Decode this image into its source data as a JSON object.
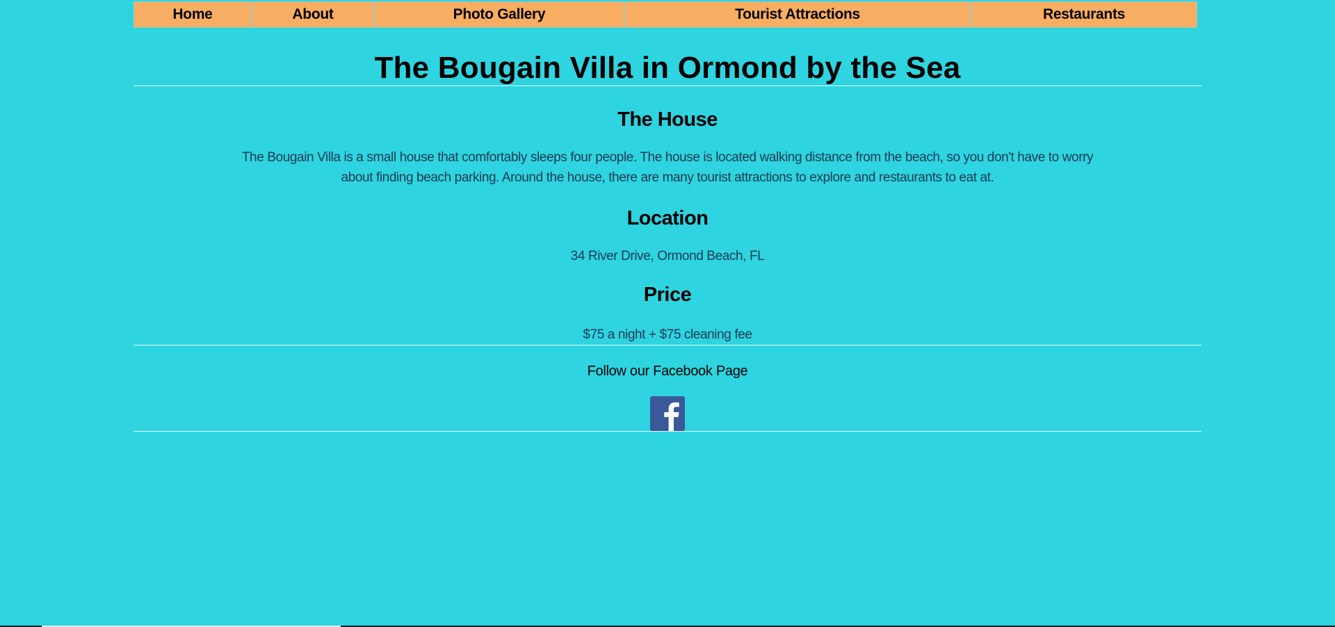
{
  "nav": {
    "items": [
      {
        "label": "Home"
      },
      {
        "label": "About"
      },
      {
        "label": "Photo Gallery"
      },
      {
        "label": "Tourist Attractions"
      },
      {
        "label": "Restaurants"
      }
    ]
  },
  "header": {
    "title": "The Bougain Villa in Ormond by the Sea"
  },
  "sections": {
    "house": {
      "heading": "The House",
      "text": "The Bougain Villa is a small house that comfortably sleeps four people. The house is located walking distance from the beach, so you don't have to worry about finding beach parking. Around the house, there are many tourist attractions to explore and restaurants to eat at."
    },
    "location": {
      "heading": "Location",
      "text": "34 River Drive, Ormond Beach, FL"
    },
    "price": {
      "heading": "Price",
      "text": "$75 a night + $75 cleaning fee"
    }
  },
  "footer": {
    "follow_text": "Follow our Facebook Page",
    "social_icon": "facebook-icon"
  },
  "colors": {
    "background": "#2ed4e0",
    "nav_background": "#f7ad62",
    "facebook_blue": "#3b5998"
  }
}
